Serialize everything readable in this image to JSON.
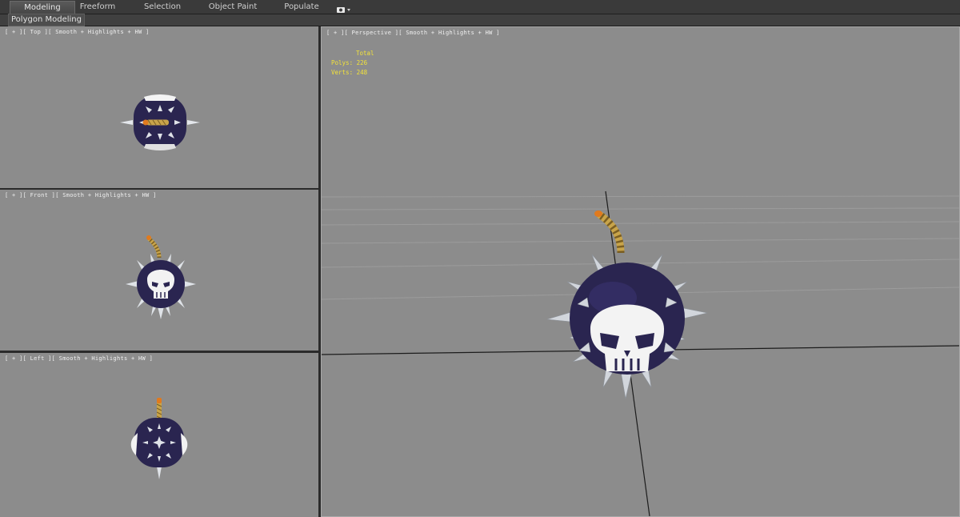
{
  "ribbon": {
    "tabs": [
      {
        "label": "Modeling",
        "active": true
      },
      {
        "label": "Freeform",
        "active": false
      },
      {
        "label": "Selection",
        "active": false
      },
      {
        "label": "Object Paint",
        "active": false
      },
      {
        "label": "Populate",
        "active": false
      }
    ],
    "extra_icon": "camera-dropdown-icon",
    "panel_label": "Polygon Modeling"
  },
  "viewports": {
    "top": {
      "label": "[ + ][ Top ][ Smooth + Highlights + HW ]"
    },
    "front": {
      "label": "[ + ][ Front ][ Smooth + Highlights + HW ]"
    },
    "left": {
      "label": "[ + ][ Left ][ Smooth + Highlights + HW ]"
    },
    "perspective": {
      "label": "[ + ][ Perspective ][ Smooth + Highlights + HW ]",
      "stats": {
        "total_label": "Total",
        "polys_label": "Polys:",
        "polys_value": "226",
        "verts_label": "Verts:",
        "verts_value": "248"
      }
    }
  },
  "colors": {
    "viewport_bg": "#8c8c8c",
    "stats_text": "#f2e23a",
    "bomb_body": "#2a2550",
    "skull": "#f2f2f2",
    "spike": "#c8ccd2",
    "fuse": "#c8a44a",
    "fuse_tip": "#e07a1e"
  }
}
